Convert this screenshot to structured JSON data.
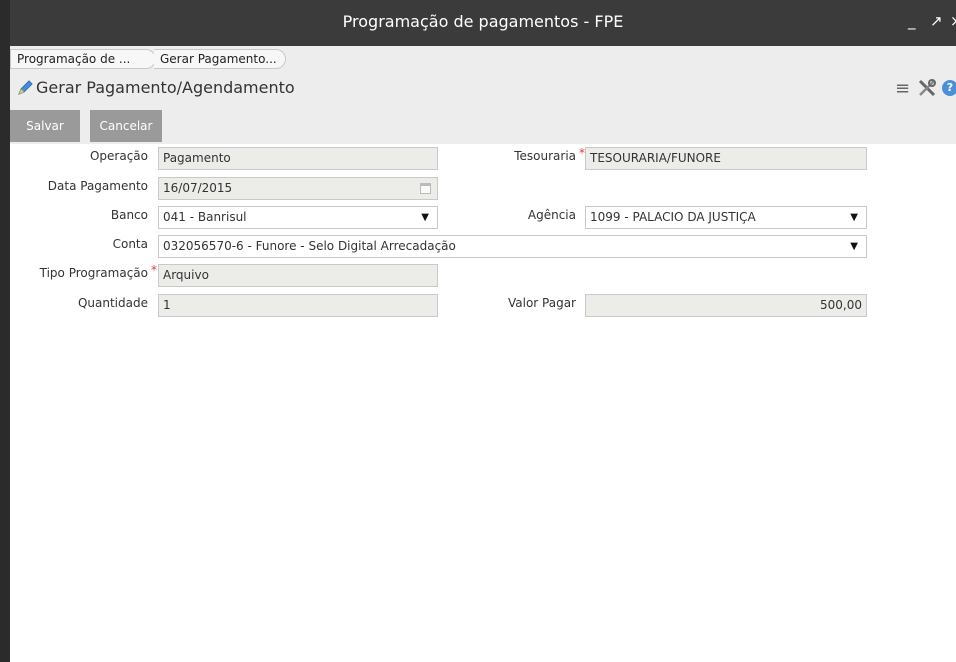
{
  "window": {
    "title": "Programação de pagamentos - FPE",
    "controls": {
      "minimize": "_",
      "maximize": "↗",
      "close": "×"
    }
  },
  "tabs": [
    {
      "label": "Programação de ..."
    },
    {
      "label": "Gerar Pagamento..."
    }
  ],
  "header": {
    "title": "Gerar Pagamento/Agendamento",
    "icons": [
      "edit-icon",
      "menu-icon",
      "tools-icon",
      "help-icon"
    ]
  },
  "toolbar": {
    "save_label": "Salvar",
    "cancel_label": "Cancelar"
  },
  "form": {
    "operacao": {
      "label": "Operação",
      "value": "Pagamento"
    },
    "tesouraria": {
      "label": "Tesouraria",
      "value": "TESOURARIA/FUNORE",
      "required": true
    },
    "data_pagamento": {
      "label": "Data Pagamento",
      "value": "16/07/2015"
    },
    "banco": {
      "label": "Banco",
      "value": "041 - Banrisul"
    },
    "agencia": {
      "label": "Agência",
      "value": "1099 - PALACIO DA JUSTIÇA"
    },
    "conta": {
      "label": "Conta",
      "value": "032056570-6 - Funore - Selo Digital Arrecadação"
    },
    "tipo_programacao": {
      "label": "Tipo Programação",
      "value": "Arquivo",
      "required": true
    },
    "quantidade": {
      "label": "Quantidade",
      "value": "1"
    },
    "valor_pagar": {
      "label": "Valor Pagar",
      "value": "500,00"
    },
    "required_mark": "*"
  },
  "colors": {
    "titlebar": "#3b3b3b",
    "panel": "#ededed",
    "button": "#9a9a9a",
    "required": "#e53935",
    "field_readonly": "#ecece8"
  }
}
